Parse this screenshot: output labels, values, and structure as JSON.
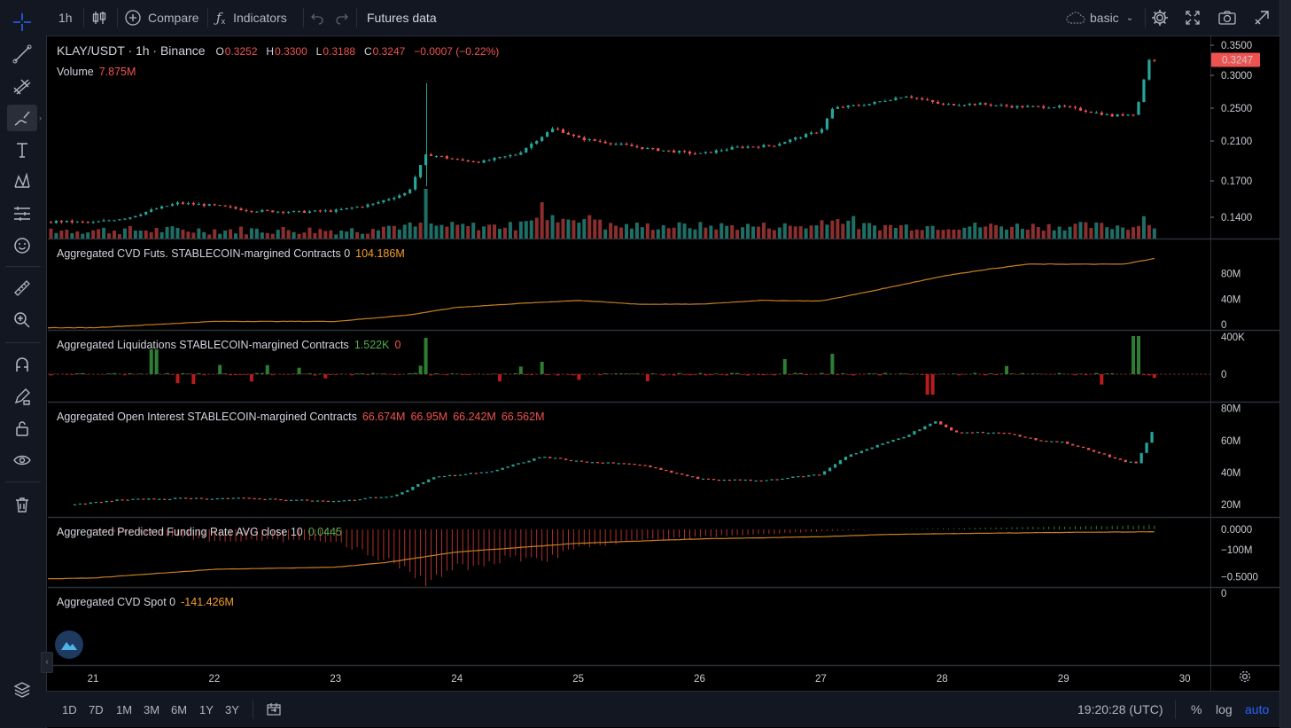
{
  "toolbar": {
    "interval": "1h",
    "compare": "Compare",
    "indicators": "Indicators",
    "futures": "Futures data",
    "layout": "basic"
  },
  "legend": {
    "symbol": "KLAY/USDT · 1h · Binance",
    "o_lbl": "O",
    "o": "0.3252",
    "h_lbl": "H",
    "h": "0.3300",
    "l_lbl": "L",
    "l": "0.3188",
    "c_lbl": "C",
    "c": "0.3247",
    "chg": "−0.0007 (−0.22%)",
    "volume_label": "Volume",
    "volume": "7.875M"
  },
  "panes": {
    "cvd_futs": {
      "label": "Aggregated CVD Futs. STABLECOIN-margined Contracts 0",
      "value": "104.186M"
    },
    "liq": {
      "label": "Aggregated Liquidations STABLECOIN-margined Contracts",
      "v1": "1.522K",
      "v2": "0"
    },
    "oi": {
      "label": "Aggregated Open Interest STABLECOIN-margined Contracts",
      "o": "66.674M",
      "h": "66.95M",
      "l": "66.242M",
      "c": "66.562M"
    },
    "funding": {
      "label": "Aggregated Predicted Funding Rate AVG close 10",
      "value": "0.0445"
    },
    "cvd_spot": {
      "label": "Aggregated CVD Spot 0",
      "value": "-141.426M"
    }
  },
  "price_axis": {
    "price": [
      "0.3500",
      "0.3000",
      "0.2500",
      "0.2100",
      "0.1700",
      "0.1400"
    ],
    "last": "0.3247",
    "cvd_futs": [
      "80M",
      "40M",
      "0"
    ],
    "liq": [
      "400K",
      "0"
    ],
    "oi": [
      "80M",
      "60M",
      "40M",
      "20M"
    ],
    "funding": [
      "0.0000",
      "−0.5000"
    ],
    "cvd_spot": [
      "0",
      "−100M"
    ]
  },
  "time_axis": [
    "21",
    "22",
    "23",
    "24",
    "25",
    "26",
    "27",
    "28",
    "29",
    "30"
  ],
  "bottom": {
    "ranges": [
      "1D",
      "7D",
      "1M",
      "3M",
      "6M",
      "1Y",
      "3Y"
    ],
    "clock": "19:20:28 (UTC)",
    "pct": "%",
    "log": "log",
    "auto": "auto"
  },
  "colors": {
    "up": "#26a69a",
    "down": "#ef5350",
    "cvd": "#f59f2d",
    "accent": "#2962ff",
    "bg": "#000000",
    "panel": "#131722"
  },
  "chart_data": {
    "type": "candlestick",
    "title": "KLAY/USDT · 1h · Binance",
    "x_ticks": [
      "21",
      "22",
      "23",
      "24",
      "25",
      "26",
      "27",
      "28",
      "29",
      "30"
    ],
    "price_path": [
      [
        20.0,
        0.138
      ],
      [
        20.3,
        0.136
      ],
      [
        20.5,
        0.134
      ],
      [
        20.7,
        0.137
      ],
      [
        21.0,
        0.136
      ],
      [
        21.3,
        0.14
      ],
      [
        21.5,
        0.146
      ],
      [
        21.7,
        0.151
      ],
      [
        22.0,
        0.149
      ],
      [
        22.3,
        0.145
      ],
      [
        22.7,
        0.144
      ],
      [
        23.0,
        0.145
      ],
      [
        23.3,
        0.15
      ],
      [
        23.6,
        0.16
      ],
      [
        23.75,
        0.196
      ],
      [
        24.0,
        0.19
      ],
      [
        24.2,
        0.188
      ],
      [
        24.5,
        0.196
      ],
      [
        24.8,
        0.225
      ],
      [
        25.0,
        0.213
      ],
      [
        25.3,
        0.207
      ],
      [
        25.6,
        0.201
      ],
      [
        26.0,
        0.196
      ],
      [
        26.3,
        0.203
      ],
      [
        26.6,
        0.205
      ],
      [
        27.0,
        0.222
      ],
      [
        27.1,
        0.25
      ],
      [
        27.4,
        0.256
      ],
      [
        27.7,
        0.268
      ],
      [
        28.0,
        0.255
      ],
      [
        28.3,
        0.256
      ],
      [
        28.6,
        0.252
      ],
      [
        29.0,
        0.252
      ],
      [
        29.4,
        0.24
      ],
      [
        29.6,
        0.243
      ],
      [
        29.7,
        0.324
      ],
      [
        29.75,
        0.3247
      ]
    ],
    "price_ylim": [
      0.125,
      0.36
    ],
    "volume_spikes": [
      {
        "x": 23.75,
        "rel": 1.0
      },
      {
        "x": 24.7,
        "rel": 0.73
      },
      {
        "x": 29.65,
        "rel": 0.45
      }
    ],
    "cvd_futs": {
      "x": [
        20.0,
        21.0,
        21.5,
        22.0,
        23.0,
        23.6,
        24.0,
        24.5,
        25.0,
        25.5,
        26.0,
        26.5,
        27.0,
        27.3,
        27.6,
        28.0,
        28.3,
        28.7,
        29.0,
        29.5,
        29.75
      ],
      "y": [
        -5,
        -5,
        0,
        5,
        5,
        15,
        27,
        33,
        38,
        32,
        32,
        38,
        37,
        48,
        60,
        76,
        85,
        95,
        95,
        95,
        104.186
      ]
    },
    "liquidations_spikes": [
      {
        "x": 21.5,
        "v": 280
      },
      {
        "x": 23.75,
        "v": 410
      },
      {
        "x": 24.7,
        "v": 140
      },
      {
        "x": 26.7,
        "v": 170
      },
      {
        "x": 27.1,
        "v": 230
      },
      {
        "x": 27.9,
        "v": -230
      },
      {
        "x": 29.6,
        "v": 430
      }
    ],
    "open_interest": {
      "x": [
        20.85,
        21.2,
        21.7,
        22.3,
        23.0,
        23.5,
        23.8,
        24.3,
        24.7,
        25.0,
        25.5,
        26.0,
        26.5,
        27.0,
        27.2,
        27.7,
        27.95,
        28.1,
        28.5,
        28.8,
        29.0,
        29.5,
        29.6,
        29.75
      ],
      "y": [
        20,
        23,
        24,
        24,
        22,
        26,
        37,
        41,
        50,
        47,
        45,
        36,
        35,
        39,
        50,
        63,
        72,
        65,
        65,
        60,
        59,
        47,
        46,
        68
      ]
    },
    "oi_ylim": [
      14,
      82
    ],
    "funding_rate": {
      "x": [
        21.0,
        21.5,
        22.0,
        23.0,
        23.5,
        23.7,
        24.0,
        24.5,
        24.8,
        25.0,
        25.5,
        26.0,
        26.5,
        27.0,
        27.5,
        28.0,
        28.5,
        29.0,
        29.5,
        29.75
      ],
      "y": [
        -0.02,
        -0.05,
        -0.12,
        -0.12,
        -0.38,
        -0.55,
        -0.4,
        -0.3,
        -0.3,
        -0.18,
        -0.12,
        -0.08,
        -0.05,
        -0.02,
        0.0,
        0.01,
        0.02,
        0.03,
        0.04,
        0.0445
      ]
    },
    "cvd_spot": {
      "x": [
        20.0,
        21.0,
        21.5,
        22.0,
        23.0,
        23.4,
        24.0,
        25.0,
        26.0,
        27.0,
        27.5,
        28.0,
        29.0,
        29.75
      ],
      "y": [
        -30,
        -35,
        -45,
        -55,
        -60,
        -70,
        -95,
        -115,
        -125,
        -130,
        -135,
        -137,
        -140,
        -141.426
      ]
    }
  }
}
